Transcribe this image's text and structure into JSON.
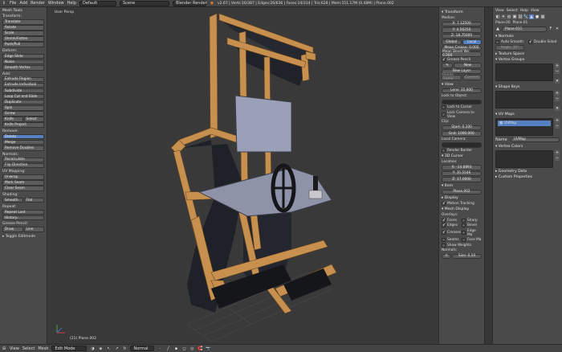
{
  "topbar": {
    "menus": [
      "File",
      "Add",
      "Render",
      "Window",
      "Help"
    ],
    "layout": "Default",
    "scene": "Scene",
    "engine": "Blender Render",
    "stats": "v2.67 | Verts:16/387 | Edges:26/636 | Faces:14/314 | Tris:628 | Mem:151.17M (0.48M) | Plane.002"
  },
  "toolshelf": {
    "title": "Mesh Tools",
    "transform_head": "Transform:",
    "transform": [
      "Translate",
      "Rotate",
      "Scale",
      "Shrink/Fatten",
      "Push/Pull"
    ],
    "deform_head": "Deform:",
    "deform": [
      "Edge Slide",
      "Noise",
      "Smooth Vertex"
    ],
    "add_head": "Add:",
    "add": [
      "Extrude Region",
      "Extrude Individual",
      "Subdivide",
      "Loop Cut and Slide",
      "Duplicate",
      "Spin",
      "Screw"
    ],
    "knife": "Knife",
    "select": "Select",
    "knife_project": "Knife Project",
    "remove_head": "Remove:",
    "remove": [
      "Delete",
      "Merge",
      "Remove Doubles"
    ],
    "normals_head": "Normals:",
    "normals": [
      "Recalculate",
      "Flip Direction"
    ],
    "uv_head": "UV Mapping:",
    "uv": [
      "Unwrap",
      "Mark Seam",
      "Clear Seam"
    ],
    "shading_head": "Shading:",
    "smooth": "Smooth",
    "flat": "Flat",
    "repeat_head": "Repeat:",
    "repeat": [
      "Repeat Last",
      "History..."
    ],
    "pencil_head": "Grease Pencil:",
    "draw": "Draw",
    "line": "Line",
    "toggle": "▸ Toggle Editmode"
  },
  "viewport": {
    "label": "User Persp",
    "object_label": "(21) Plane.002"
  },
  "npanel": {
    "transform": "▾ Transform",
    "median": "Median:",
    "x": "X: 7.12500",
    "y": "Y: 4.56250",
    "z": "Z: 18.75000",
    "global": "Global",
    "local": "Local",
    "crease": "Mean Crease: 0.000",
    "bevel": "Mean Bevel We: 0.000",
    "grease": "Grease Pencil",
    "new": "New",
    "new_layer": "New Layer",
    "delete_frame": "Delete Frame",
    "convert": "Convert",
    "view": "▾ View",
    "lens": "Lens: 35.000",
    "lock_object": "Lock to Object:",
    "lock_cursor": "Lock to Cursor",
    "lock_camera": "Lock Camera to View",
    "clip": "Clip:",
    "start": "Start: 0.100",
    "end": "End: 1000.000",
    "local_camera": "Local Camera:",
    "render_border": "Render Border",
    "cursor": "▾ 3D Cursor",
    "location": "Location:",
    "cx": "X: -14.0893",
    "cy": "Y: 35.5546",
    "cz": "Z: 17.0000",
    "item": "▾ Item",
    "item_name": "Plane.002",
    "display": "▸ Display",
    "motion": "Motion Tracking",
    "mesh_display": "▾ Mesh Display",
    "overlays": "Overlays:",
    "faces": "Faces",
    "sharp": "Sharp",
    "edges": "Edges",
    "bevel2": "Bevel",
    "creases": "Creases",
    "edge_ma": "Edge Ma",
    "seams": "Seams",
    "face_ma": "Face Ma",
    "weights": "Show Weights",
    "normals": "Normals:",
    "size": "Size: 0.10"
  },
  "props": {
    "tabs": [
      "View",
      "Select",
      "Help",
      "View"
    ],
    "object": "Plane.00",
    "mesh": "Plane.01",
    "datablock": "Plane.011",
    "normals": "▾ Normals",
    "auto_smooth": "Auto Smooth",
    "double_sided": "Double Sided",
    "angle": "Angle: 30°",
    "texture_space": "▸ Texture Space",
    "vertex_groups": "▾ Vertex Groups",
    "shape_keys": "▾ Shape Keys",
    "uv_maps": "▾ UV Maps",
    "uv_item": "UVMap",
    "name_label": "Name",
    "name_value": "UVMap",
    "vertex_colors": "▾ Vertex Colors",
    "geometry_data": "▸ Geometry Data",
    "custom_props": "▸ Custom Properties"
  },
  "bottombar": {
    "items": [
      "View",
      "Select",
      "Mesh"
    ],
    "mode": "Edit Mode",
    "shading": "Normal"
  }
}
